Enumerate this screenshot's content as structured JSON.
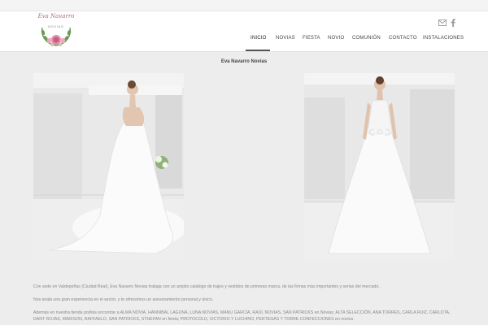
{
  "brand": {
    "logo_script": "Eva Navarro",
    "logo_sub": "NOVIAS"
  },
  "social": [
    {
      "icon": "mail-icon"
    },
    {
      "icon": "facebook-icon"
    }
  ],
  "nav": {
    "items": [
      {
        "label": "INICIO",
        "active": true
      },
      {
        "label": "NOVIAS"
      },
      {
        "label": "FIESTA"
      },
      {
        "label": "NOVIO"
      },
      {
        "label": "COMUNIÓN"
      },
      {
        "label": "CONTACTO"
      },
      {
        "label": "INSTALACIONES"
      }
    ]
  },
  "main": {
    "title": "Eva Navarro Novias",
    "paragraphs": [
      "Con sede en Valdepeñas (Ciudad Real), Eva Navarro Novias trabaja con un amplio catálogo de trajes y vestidos de primeras marca, de las firmas más importantes y serias del mercado.",
      "Nos avala una gran experiencia en el sector, y te ofrecemos un asesoramiento personal y único.",
      "Además en nuestra tienda podrás encontrar a ALMA NOVIA, HANNIBAL LAGUNA, LUNA NOVIAS, MANU GARCÍA, RAÚL NOVIAS, SAN PATRICKS en Novias; ALTA SELECCIÓN, ANA TORRES, CARLA RUIZ, CARLOTA, DANT ROJAS, MADISON, RAFFAELO, SAN PATRICKS, STHEFAN en fiesta; PROTOCOLO, VICTORIO Y LUCHINO, PERTEGAS Y TORRE CONFECCIONES en novios."
    ]
  },
  "colors": {
    "background": "#ededed",
    "header": "#ffffff",
    "accent_logo": "#b06a82"
  }
}
